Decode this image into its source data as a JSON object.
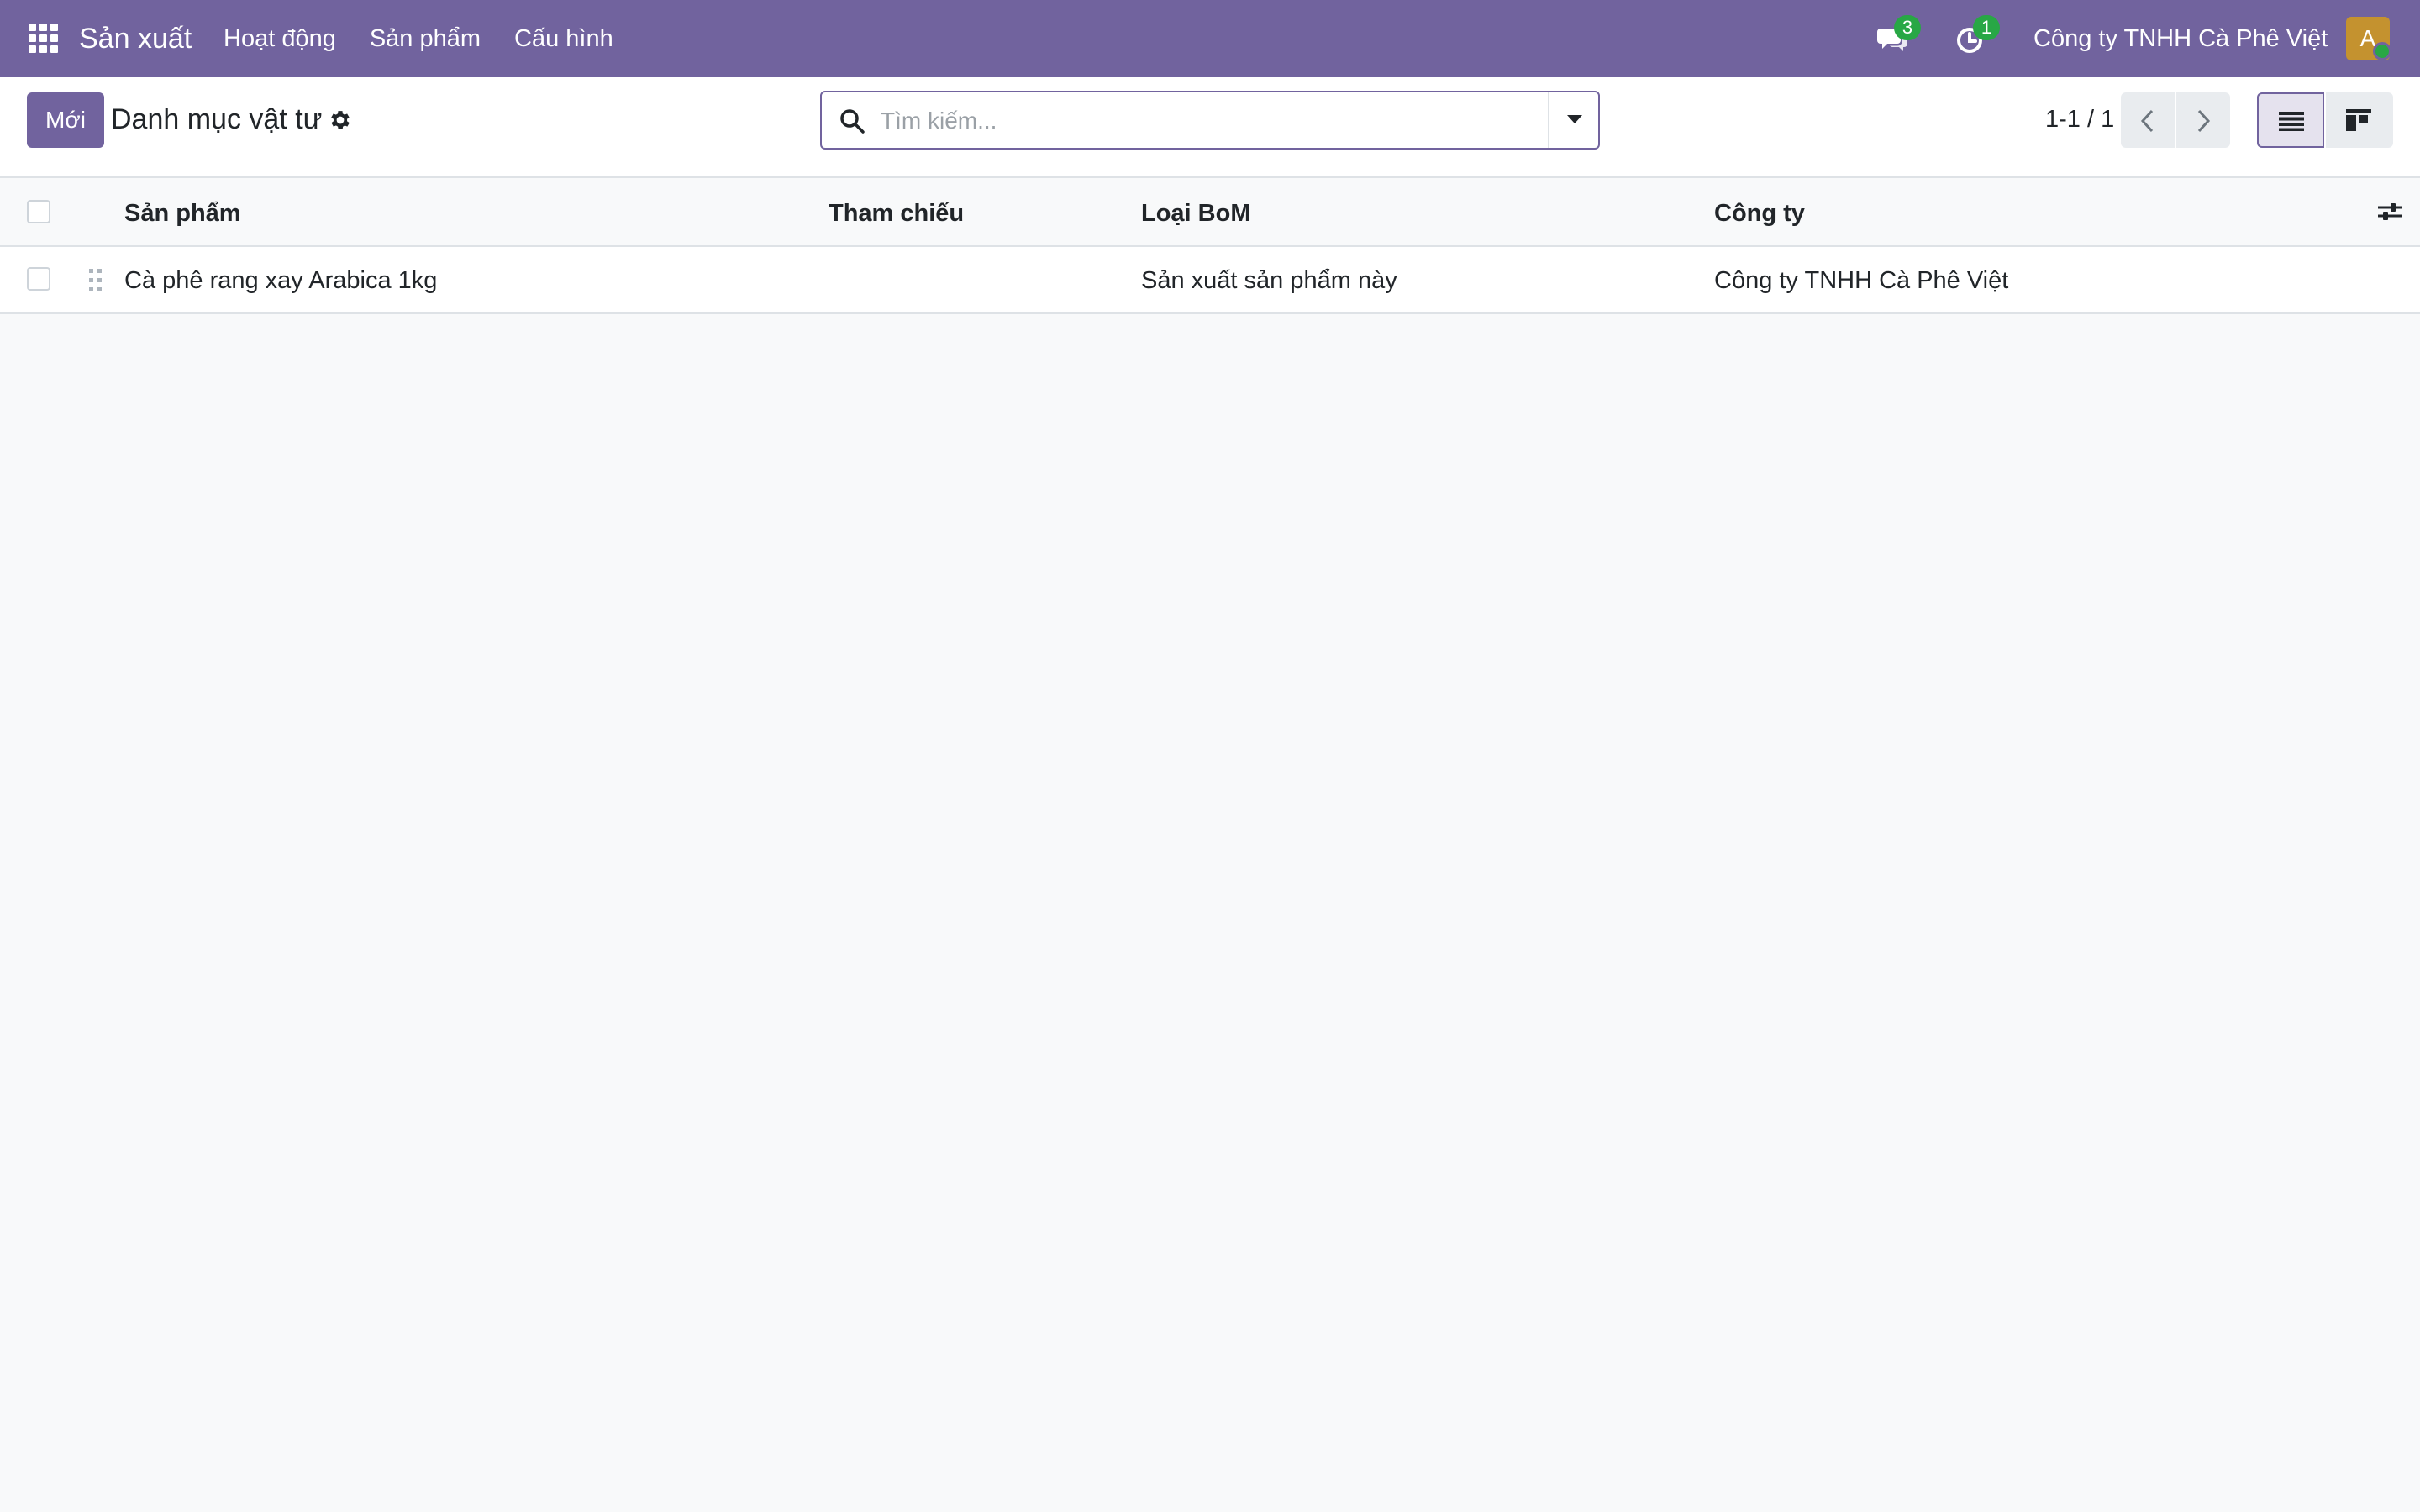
{
  "navbar": {
    "app_name": "Sản xuất",
    "menu": [
      {
        "label": "Hoạt động"
      },
      {
        "label": "Sản phẩm"
      },
      {
        "label": "Cấu hình"
      }
    ],
    "messages_badge": "3",
    "activities_badge": "1",
    "company": "Công ty TNHH Cà Phê Việt",
    "avatar_initial": "A"
  },
  "control_panel": {
    "new_button": "Mới",
    "breadcrumb": "Danh mục vật tư",
    "search_placeholder": "Tìm kiếm...",
    "search_value": "",
    "pager": "1-1 / 1"
  },
  "table": {
    "columns": [
      "Sản phẩm",
      "Tham chiếu",
      "Loại BoM",
      "Công ty"
    ],
    "rows": [
      {
        "product": "Cà phê rang xay Arabica 1kg",
        "reference": "",
        "bom_type": "Sản xuất sản phẩm này",
        "company": "Công ty TNHH Cà Phê Việt"
      }
    ]
  },
  "colors": {
    "brand": "#71639e",
    "badge": "#28a745",
    "avatar": "#c4922f"
  }
}
